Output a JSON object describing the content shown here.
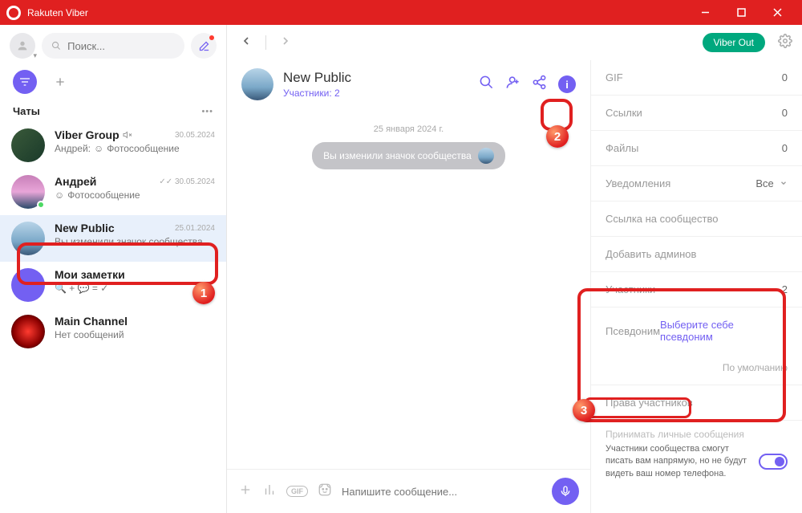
{
  "window": {
    "title": "Rakuten Viber"
  },
  "top": {
    "search_placeholder": "Поиск...",
    "viber_out": "Viber Out"
  },
  "sidebar": {
    "chats_label": "Чаты",
    "items": [
      {
        "title": "Viber Group",
        "date": "30.05.2024",
        "prefix": "Андрей:",
        "preview": "Фотосообщение",
        "muted": true
      },
      {
        "title": "Андрей",
        "date": "30.05.2024",
        "preview": "Фотосообщение",
        "sent": true,
        "online": true
      },
      {
        "title": "New Public",
        "date": "25.01.2024",
        "preview": "Вы изменили значок сообщества",
        "selected": true
      },
      {
        "title": "Мои заметки",
        "preview": "🔍 + 💬 = ✓"
      },
      {
        "title": "Main Channel",
        "preview": "Нет сообщений"
      }
    ]
  },
  "chat": {
    "name": "New Public",
    "members": "Участники: 2",
    "date_separator": "25 января 2024 г.",
    "system_message": "Вы изменили значок сообщества",
    "input_placeholder": "Напишите сообщение..."
  },
  "info": {
    "gif": {
      "label": "GIF",
      "value": "0"
    },
    "links": {
      "label": "Ссылки",
      "value": "0"
    },
    "files": {
      "label": "Файлы",
      "value": "0"
    },
    "notifications": {
      "label": "Уведомления",
      "value": "Все"
    },
    "community_link": "Ссылка на сообщество",
    "add_admins": "Добавить админов",
    "participants": {
      "label": "Участники",
      "value": "2"
    },
    "alias": {
      "label": "Псевдоним",
      "action": "Выберите себе псевдоним",
      "default": "По умолчанию"
    },
    "rights": "Права участников",
    "direct": {
      "title": "Принимать личные сообщения",
      "desc": "Участники сообщества смогут писать вам напрямую, но не будут видеть ваш номер телефона."
    }
  }
}
